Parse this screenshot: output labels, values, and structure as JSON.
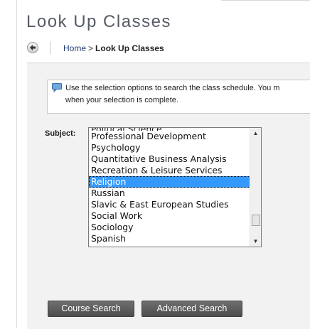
{
  "page": {
    "title": "Look Up Classes"
  },
  "breadcrumb": {
    "home": "Home",
    "separator": ">",
    "current": "Look Up Classes"
  },
  "info": {
    "text": "Use the selection options to search the class schedule. You m",
    "text2": "when your selection is complete."
  },
  "subject": {
    "label": "Subject:",
    "partial_item": "Political Science",
    "items": [
      "Professional Development",
      "Psychology",
      "Quantitative Business Analysis",
      "Recreation & Leisure Services",
      "Religion",
      "Russian",
      "Slavic & East European Studies",
      "Social Work",
      "Sociology",
      "Spanish"
    ],
    "selected": "Religion"
  },
  "buttons": {
    "course_search": "Course Search",
    "advanced_search": "Advanced Search"
  },
  "colors": {
    "selection": "#3399ff",
    "button": "#5a5a5a",
    "panel": "#f2f2f2"
  }
}
